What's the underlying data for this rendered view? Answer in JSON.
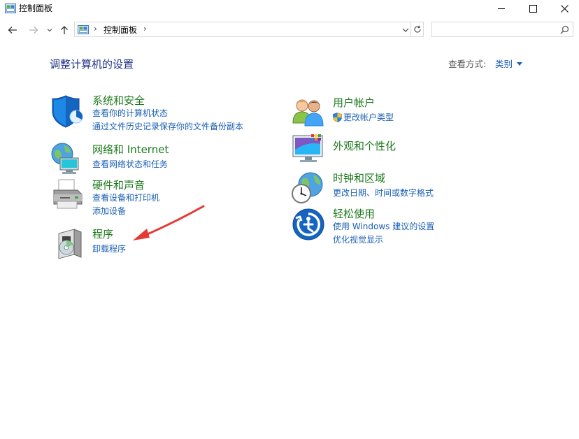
{
  "window": {
    "title": "控制面板"
  },
  "address": {
    "breadcrumb": "控制面板",
    "search_placeholder": ""
  },
  "main": {
    "heading": "调整计算机的设置",
    "view_label": "查看方式:",
    "view_value": "类别"
  },
  "categories": [
    {
      "icon": "security-shield-icon",
      "title": "系统和安全",
      "links": [
        "查看你的计算机状态",
        "通过文件历史记录保存你的文件备份副本"
      ]
    },
    {
      "icon": "network-globe-icon",
      "title": "网络和 Internet",
      "links": [
        "查看网络状态和任务"
      ]
    },
    {
      "icon": "printer-icon",
      "title": "硬件和声音",
      "links": [
        "查看设备和打印机",
        "添加设备"
      ]
    },
    {
      "icon": "programs-disc-icon",
      "title": "程序",
      "links": [
        "卸载程序"
      ]
    },
    {
      "icon": "users-icon",
      "title": "用户帐户",
      "links": [
        "更改帐户类型"
      ]
    },
    {
      "icon": "appearance-monitor-icon",
      "title": "外观和个性化",
      "links": []
    },
    {
      "icon": "clock-globe-icon",
      "title": "时钟和区域",
      "links": [
        "更改日期、时间或数字格式"
      ]
    },
    {
      "icon": "ease-of-access-icon",
      "title": "轻松使用",
      "links": [
        "使用 Windows 建议的设置",
        "优化视觉显示"
      ]
    }
  ],
  "colors": {
    "category_title": "#1d7a1d",
    "link": "#1a5fb4",
    "heading": "#1e3287",
    "annotation_arrow": "#e53935"
  }
}
